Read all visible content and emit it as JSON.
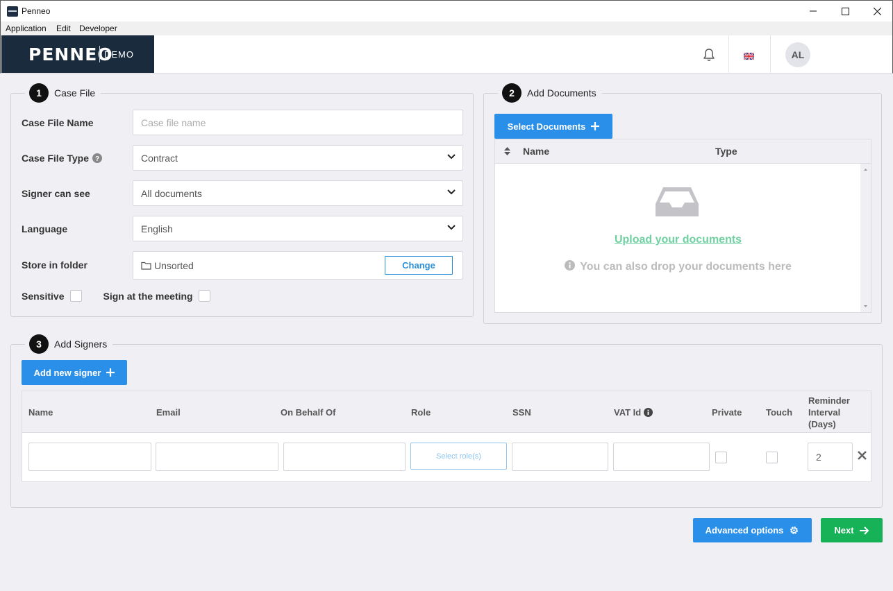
{
  "window": {
    "title": "Penneo"
  },
  "menu": [
    "Application",
    "Edit",
    "Developer"
  ],
  "header": {
    "brand_logo": "PENNEO",
    "brand_demo": "DEMO",
    "avatar": "AL",
    "language_flag": "uk-flag"
  },
  "case_file": {
    "step": "1",
    "legend": "Case File",
    "name_label": "Case File Name",
    "name_placeholder": "Case file name",
    "type_label": "Case File Type",
    "type_value": "Contract",
    "signer_see_label": "Signer can see",
    "signer_see_value": "All documents",
    "language_label": "Language",
    "language_value": "English",
    "folder_label": "Store in folder",
    "folder_value": "Unsorted",
    "change_label": "Change",
    "sensitive_label": "Sensitive",
    "meeting_label": "Sign at the meeting"
  },
  "documents": {
    "step": "2",
    "legend": "Add Documents",
    "select_label": "Select Documents",
    "col_name": "Name",
    "col_type": "Type",
    "upload_link": "Upload your documents",
    "drop_note": "You can also drop your documents here"
  },
  "signers": {
    "step": "3",
    "legend": "Add Signers",
    "add_label": "Add new signer",
    "columns": {
      "name": "Name",
      "email": "Email",
      "on_behalf": "On Behalf Of",
      "role": "Role",
      "ssn": "SSN",
      "vat": "VAT Id",
      "private": "Private",
      "touch": "Touch",
      "reminder_1": "Reminder",
      "reminder_2": "Interval",
      "reminder_3": "(Days)"
    },
    "row": {
      "role_button": "Select role(s)",
      "reminder_value": "2"
    }
  },
  "footer": {
    "advanced_label": "Advanced options",
    "next_label": "Next"
  },
  "colors": {
    "primary": "#2a8fe8",
    "success": "#17b257",
    "brand": "#1b2b3e",
    "link": "#6fd0a0"
  },
  "icons": [
    "bell-icon",
    "help-icon",
    "chevron-down-icon",
    "folder-icon",
    "plus-icon",
    "sort-icon",
    "inbox-icon",
    "info-icon",
    "close-icon",
    "gear-icon",
    "arrow-right-icon"
  ]
}
